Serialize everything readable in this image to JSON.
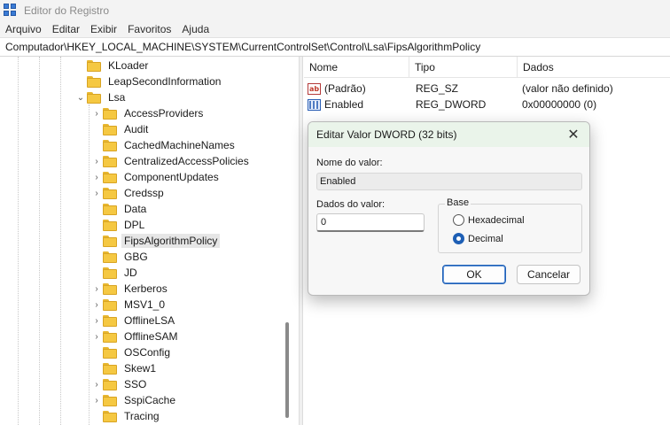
{
  "window": {
    "title": "Editor do Registro"
  },
  "menu": [
    "Arquivo",
    "Editar",
    "Exibir",
    "Favoritos",
    "Ajuda"
  ],
  "address": "Computador\\HKEY_LOCAL_MACHINE\\SYSTEM\\CurrentControlSet\\Control\\Lsa\\FipsAlgorithmPolicy",
  "tree": {
    "items": [
      {
        "label": "KLoader",
        "expander": "",
        "selected": false
      },
      {
        "label": "LeapSecondInformation",
        "expander": "",
        "selected": false
      },
      {
        "label": "Lsa",
        "expander": "expanded",
        "selected": false
      },
      {
        "label": "AccessProviders",
        "expander": "collapsed",
        "selected": false
      },
      {
        "label": "Audit",
        "expander": "",
        "selected": false
      },
      {
        "label": "CachedMachineNames",
        "expander": "",
        "selected": false
      },
      {
        "label": "CentralizedAccessPolicies",
        "expander": "collapsed",
        "selected": false
      },
      {
        "label": "ComponentUpdates",
        "expander": "collapsed",
        "selected": false
      },
      {
        "label": "Credssp",
        "expander": "collapsed",
        "selected": false
      },
      {
        "label": "Data",
        "expander": "",
        "selected": false
      },
      {
        "label": "DPL",
        "expander": "",
        "selected": false
      },
      {
        "label": "FipsAlgorithmPolicy",
        "expander": "",
        "selected": true
      },
      {
        "label": "GBG",
        "expander": "",
        "selected": false
      },
      {
        "label": "JD",
        "expander": "",
        "selected": false
      },
      {
        "label": "Kerberos",
        "expander": "collapsed",
        "selected": false
      },
      {
        "label": "MSV1_0",
        "expander": "collapsed",
        "selected": false
      },
      {
        "label": "OfflineLSA",
        "expander": "collapsed",
        "selected": false
      },
      {
        "label": "OfflineSAM",
        "expander": "collapsed",
        "selected": false
      },
      {
        "label": "OSConfig",
        "expander": "",
        "selected": false
      },
      {
        "label": "Skew1",
        "expander": "",
        "selected": false
      },
      {
        "label": "SSO",
        "expander": "collapsed",
        "selected": false
      },
      {
        "label": "SspiCache",
        "expander": "collapsed",
        "selected": false
      },
      {
        "label": "Tracing",
        "expander": "",
        "selected": false
      }
    ]
  },
  "list": {
    "columns": [
      "Nome",
      "Tipo",
      "Dados"
    ],
    "rows": [
      {
        "name": "(Padrão)",
        "type": "REG_SZ",
        "data": "(valor não definido)",
        "icon": "string-value-icon"
      },
      {
        "name": "Enabled",
        "type": "REG_DWORD",
        "data": "0x00000000 (0)",
        "icon": "dword-value-icon"
      }
    ]
  },
  "dialog": {
    "title": "Editar Valor DWORD (32 bits)",
    "name_label": "Nome do valor:",
    "name_value": "Enabled",
    "data_label": "Dados do valor:",
    "data_value": "0",
    "base_label": "Base",
    "radio_hex": "Hexadecimal",
    "radio_dec": "Decimal",
    "selected_base": "Decimal",
    "ok": "OK",
    "cancel": "Cancelar"
  },
  "colors": {
    "dialog_title_bg": "#eaf4ea",
    "accent": "#1e5fb5",
    "folder": "#f5c842"
  }
}
